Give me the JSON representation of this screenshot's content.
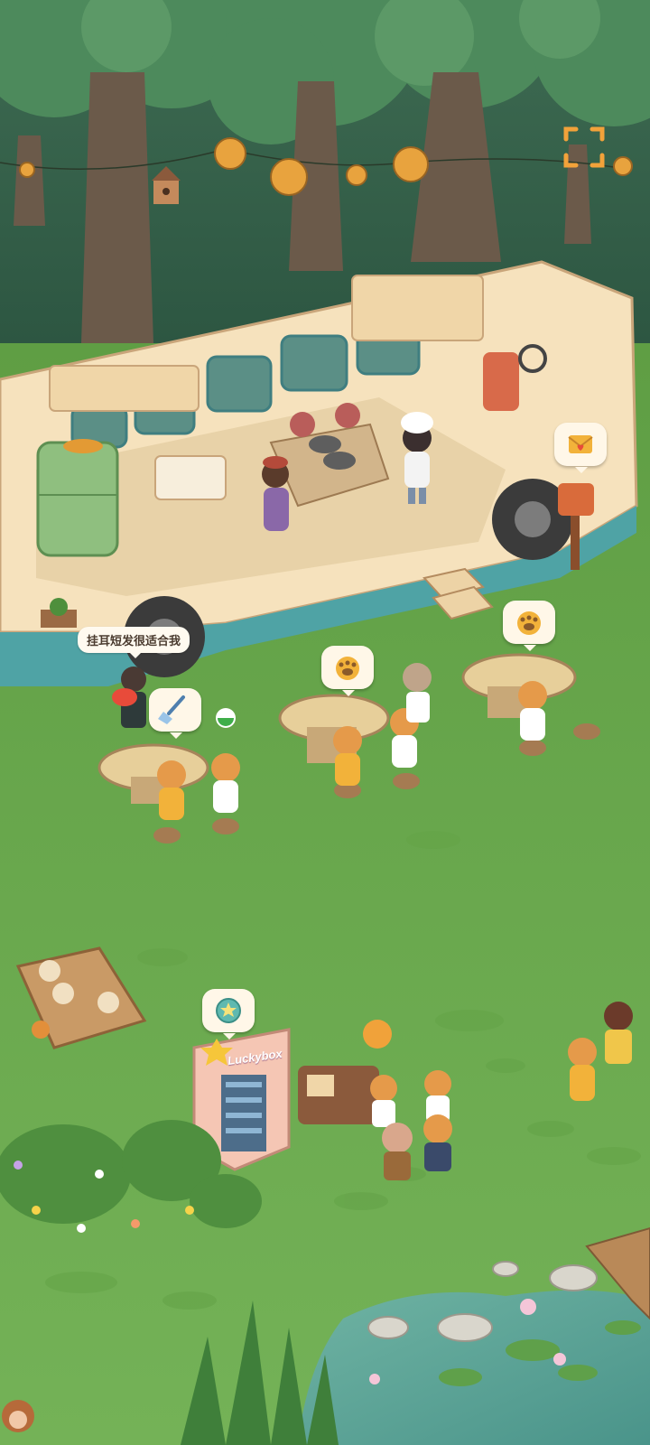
{
  "hud": {
    "fullscreen_icon": "fullscreen-icon"
  },
  "speech": {
    "customer_line": "挂耳短发很适合我"
  },
  "bubbles": {
    "clean_icon": "broom-icon",
    "paw_icon": "paw-icon",
    "mail_icon": "heart-letter-icon",
    "coin_icon": "token-icon",
    "status_icon": "green-dot-icon"
  },
  "vending_machine": {
    "label": "Luckybox"
  },
  "colors": {
    "grass": "#6fae4f",
    "forest": "#2f5a45",
    "bus_body": "#f6e2bd",
    "bus_stripe": "#4fa3a5",
    "bubble_bg": "#fff7e8",
    "accent_orange": "#f2a23a"
  }
}
